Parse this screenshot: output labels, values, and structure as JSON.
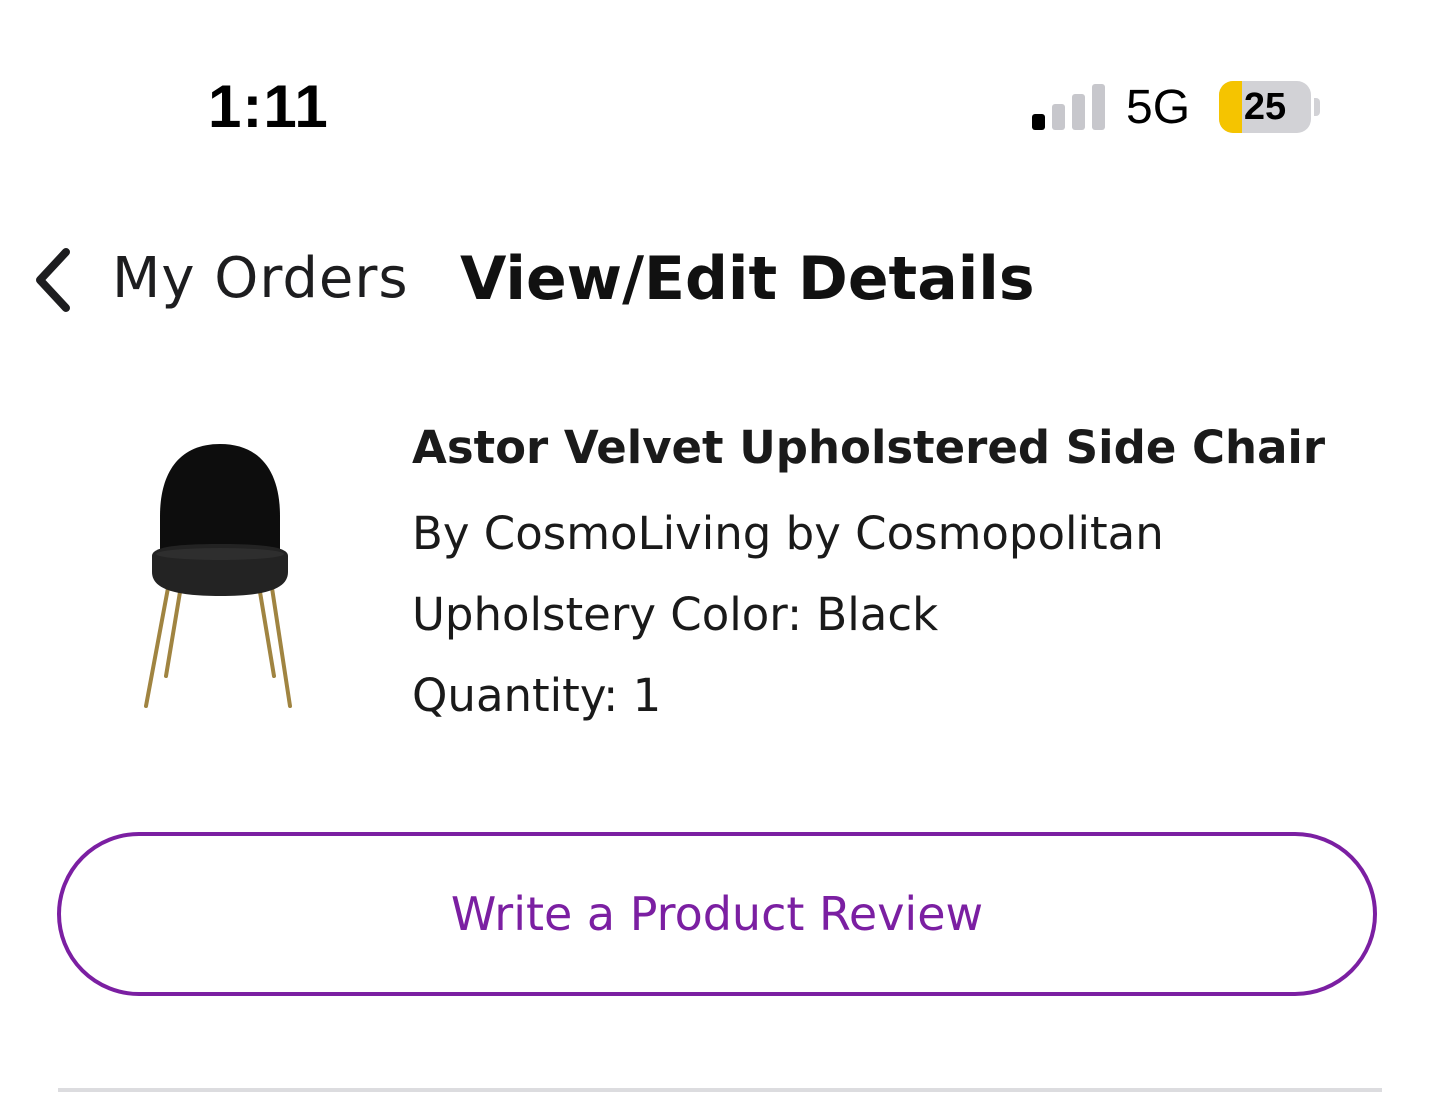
{
  "status_bar": {
    "time": "1:11",
    "network": "5G",
    "battery_percent": "25",
    "battery_color": "#f5c400",
    "signal_bars_active": 1,
    "signal_bars_total": 4
  },
  "nav": {
    "back_label": "My Orders",
    "back_icon": "chevron-left-icon",
    "title": "View/Edit Details"
  },
  "product": {
    "image": "black-velvet-side-chair",
    "name": "Astor Velvet Upholstered Side Chair",
    "brand": "By CosmoLiving by Cosmopolitan",
    "color_line": "Upholstery Color: Black",
    "quantity_line": "Quantity: 1"
  },
  "actions": {
    "review_label": "Write a Product Review",
    "accent_color": "#7b1fa2"
  }
}
